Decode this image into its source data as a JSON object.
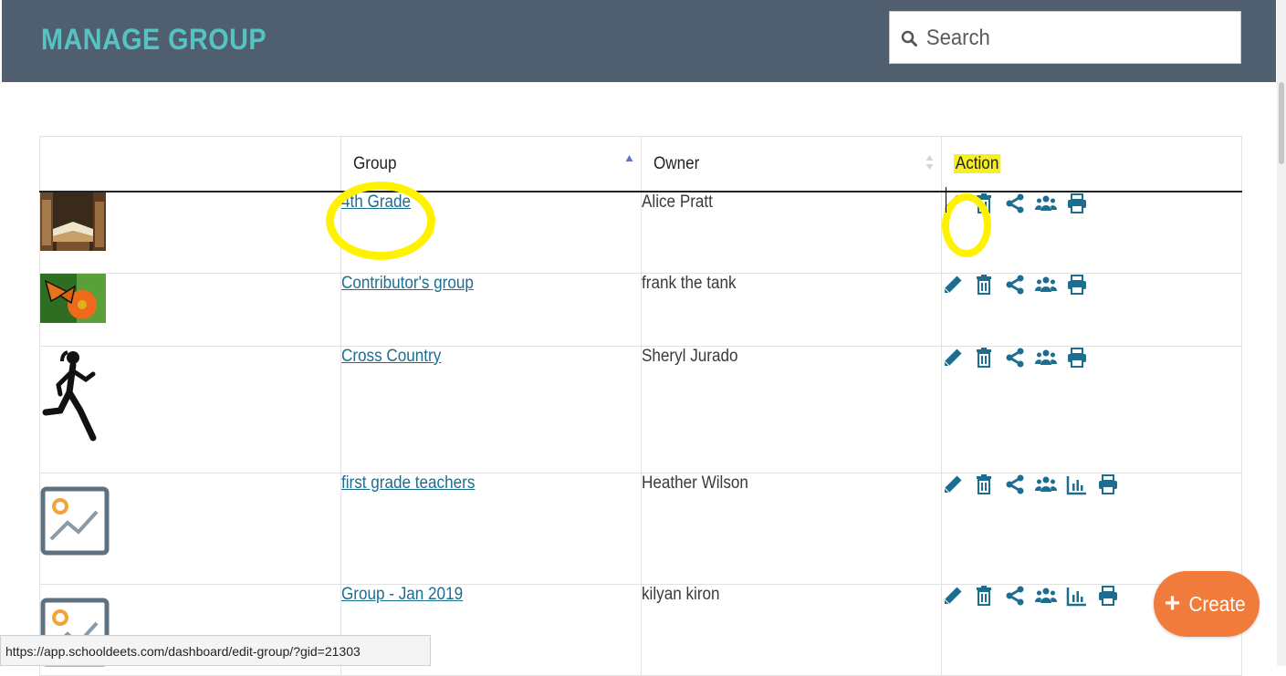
{
  "header": {
    "title": "MANAGE GROUP"
  },
  "search": {
    "placeholder": "Search",
    "value": ""
  },
  "table": {
    "columns": [
      "",
      "Group",
      "Owner",
      "Action"
    ],
    "rows": [
      {
        "image": "books-photo",
        "group": "4th Grade",
        "owner": "Alice Pratt",
        "actions": [
          "edit",
          "delete",
          "share",
          "members",
          "print"
        ]
      },
      {
        "image": "butterfly-photo",
        "group": "Contributor's group",
        "owner": "frank the tank",
        "actions": [
          "edit",
          "delete",
          "share",
          "members",
          "print"
        ]
      },
      {
        "image": "runner-silhouette",
        "group": "Cross Country",
        "owner": "Sheryl Jurado",
        "actions": [
          "edit",
          "delete",
          "share",
          "members",
          "print"
        ]
      },
      {
        "image": "image-placeholder",
        "group": "first grade teachers",
        "owner": "Heather Wilson",
        "actions": [
          "edit",
          "delete",
          "share",
          "members",
          "report",
          "print"
        ]
      },
      {
        "image": "image-placeholder",
        "group": "Group - Jan 2019",
        "owner": "kilyan kiron",
        "actions": [
          "edit",
          "delete",
          "share",
          "members",
          "report",
          "print"
        ]
      }
    ]
  },
  "create_button": {
    "label": "Create"
  },
  "status_bar": {
    "url": "https://app.schooldeets.com/dashboard/edit-group/?gid=21303"
  },
  "colors": {
    "header_bg": "#4f5f6f",
    "title": "#56c2c2",
    "accent": "#1c6e90",
    "edit_active": "#f07b3a",
    "highlight": "#fff200",
    "create_bg": "#f07b3a"
  }
}
